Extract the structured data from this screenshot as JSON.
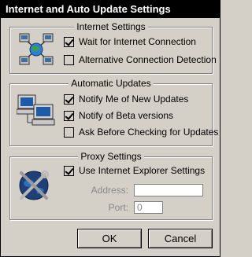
{
  "window": {
    "title": "Internet and Auto Update Settings"
  },
  "internet_settings": {
    "title": "Internet Settings",
    "icon": "network-icon",
    "options": [
      {
        "label": "Wait for Internet Connection",
        "checked": true
      },
      {
        "label": "Alternative Connection Detection",
        "checked": false
      }
    ]
  },
  "automatic_updates": {
    "title": "Automatic Updates",
    "icon": "computers-icon",
    "options": [
      {
        "label": "Notify Me of New Updates",
        "checked": true
      },
      {
        "label": "Notify of Beta versions",
        "checked": true
      },
      {
        "label": "Ask Before Checking for Updates",
        "checked": false
      }
    ]
  },
  "proxy_settings": {
    "title": "Proxy Settings",
    "icon": "globe-tools-icon",
    "use_ie": {
      "label": "Use Internet Explorer Settings",
      "checked": true
    },
    "address": {
      "label": "Address:",
      "value": ""
    },
    "port": {
      "label": "Port:",
      "value": "0"
    }
  },
  "buttons": {
    "ok": "OK",
    "cancel": "Cancel"
  }
}
